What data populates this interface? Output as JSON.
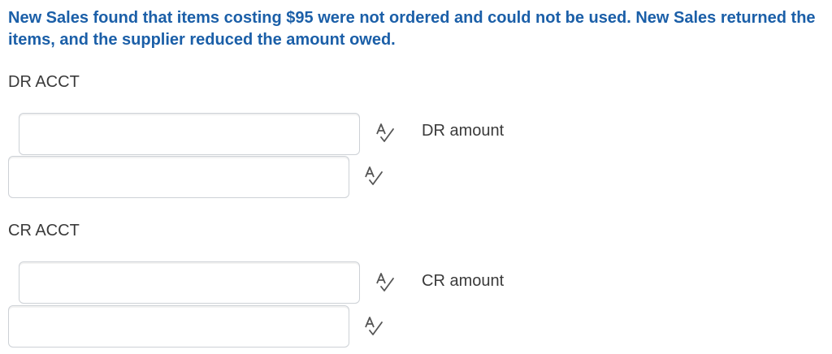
{
  "question": {
    "text": "New Sales found that items costing $95 were not ordered and could not be used. New Sales returned the items, and the supplier reduced the amount owed."
  },
  "debit": {
    "label": "DR ACCT",
    "amount_label": "DR amount",
    "account_value": "",
    "amount_value": ""
  },
  "credit": {
    "label": "CR ACCT",
    "amount_label": "CR amount",
    "account_value": "",
    "amount_value": ""
  },
  "icons": {
    "spellcheck": "spellcheck-icon"
  },
  "colors": {
    "question_text": "#1b5fa8",
    "label_text": "#3a3a3a",
    "field_border": "#cdd1d6"
  }
}
